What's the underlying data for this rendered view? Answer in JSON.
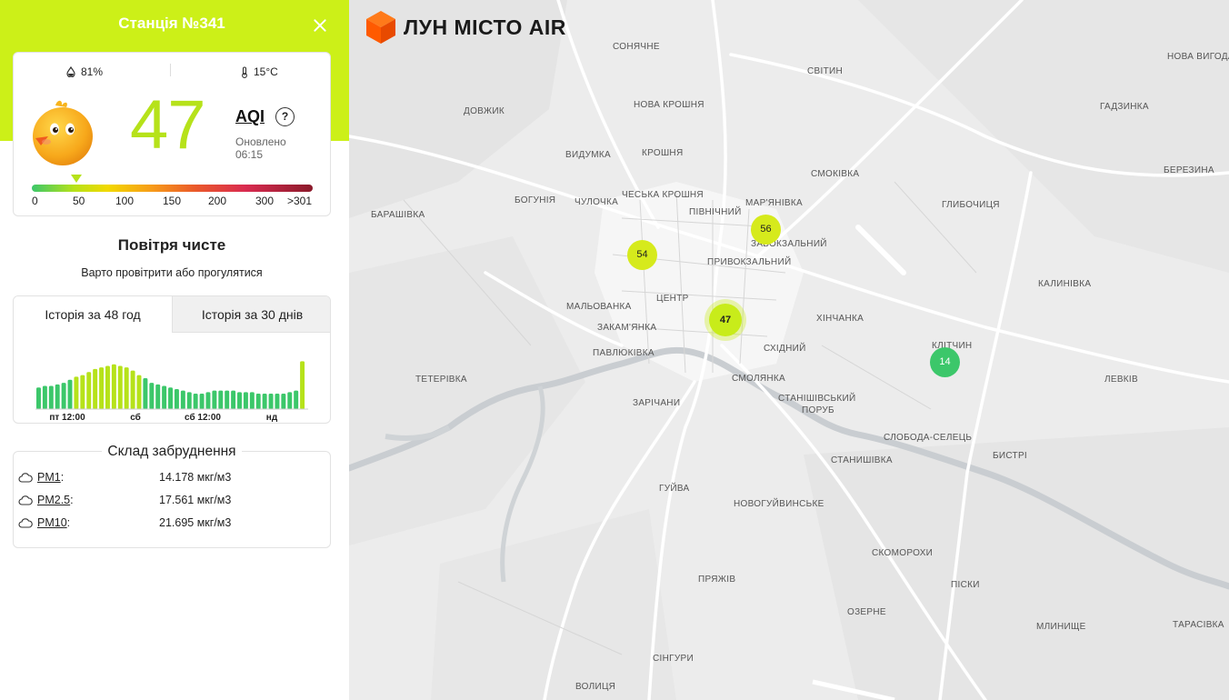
{
  "station": {
    "title": "Станція №341"
  },
  "meta": {
    "humidity": "81%",
    "temperature": "15°C"
  },
  "aqi": {
    "value": "47",
    "label": "AQI",
    "help": "?",
    "updated_label": "Оновлено",
    "updated_time": "06:15",
    "scale_ticks": [
      "0",
      "50",
      "100",
      "150",
      "200",
      "300",
      ">301"
    ],
    "color": "#b6e21a"
  },
  "status": {
    "title": "Повітря чисте",
    "advice": "Варто провітрити або прогулятися"
  },
  "history": {
    "tabs": [
      "Історія за 48 год",
      "Історія за 30 днів"
    ],
    "x_labels": [
      "пт 12:00",
      "сб",
      "сб 12:00",
      "нд"
    ]
  },
  "chart_data": {
    "type": "bar",
    "title": "",
    "values": [
      14,
      15,
      15,
      16,
      17,
      19,
      21,
      22,
      24,
      26,
      27,
      28,
      29,
      28,
      27,
      25,
      22,
      20,
      17,
      16,
      15,
      14,
      13,
      12,
      11,
      10,
      10,
      11,
      12,
      12,
      12,
      12,
      11,
      11,
      11,
      10,
      10,
      10,
      10,
      10,
      11,
      12,
      31
    ],
    "x_tick_labels": [
      "пт 12:00",
      "сб",
      "сб 12:00",
      "нд"
    ],
    "colors": [
      "#3cc76a",
      "#b6e21a"
    ]
  },
  "pollution": {
    "title": "Склад забруднення",
    "items": [
      {
        "name": "PM1",
        "sep": " :",
        "value": "14.178 мкг/м3"
      },
      {
        "name": "PM2.5",
        "sep": " :",
        "value": "17.561 мкг/м3"
      },
      {
        "name": "PM10",
        "sep": " :",
        "value": "21.695 мкг/м3"
      }
    ]
  },
  "map": {
    "logo": "ЛУН МІСТО AIR",
    "places": [
      "СОНЯЧНЕ",
      "СВІТИН",
      "НОВА ВИГОДА",
      "ДОВЖИК",
      "НОВА КРОШНЯ",
      "ГАДЗИНКА",
      "ВИДУМКА",
      "КРОШНЯ",
      "СМОКІВКА",
      "БЕРЕЗИНА",
      "БОГУНІЯ",
      "ЧУЛОЧКА",
      "ЧЕСЬКА КРОШНЯ",
      "МАР'ЯНІВКА",
      "ГЛИБОЧИЦЯ",
      "БАРАШІВКА",
      "ПІВНІЧНИЙ",
      "ЗАВОКЗАЛЬНИЙ",
      "ПРИВОКЗАЛЬНИЙ",
      "КАЛИНІВКА",
      "ЦЕНТР",
      "МАЛЬОВАНКА",
      "ХІНЧАНКА",
      "ЗАКАМ'ЯНКА",
      "СХІДНИЙ",
      "КЛІТЧИН",
      "ПАВЛЮКІВКА",
      "ТЕТЕРІВКА",
      "СМОЛЯНКА",
      "ЛЕВКІВ",
      "ЗАРІЧАНИ",
      "СТАНІШІВСЬКИЙ",
      "ПОРУБ",
      "СЛОБОДА-СЕЛЕЦЬ",
      "БИСТРІ",
      "СТАНИШІВКА",
      "ГУЙВА",
      "НОВОГУЙВИНСЬКЕ",
      "СКОМОРОХИ",
      "ПІСКИ",
      "ПРЯЖІВ",
      "ОЗЕРНЕ",
      "МЛИНИЩЕ",
      "ТАРАСІВКА",
      "СІНГУРИ",
      "ВОЛИЦЯ"
    ],
    "markers": [
      {
        "value": "54",
        "color": "#d6ea1c"
      },
      {
        "value": "56",
        "color": "#d6ea1c"
      },
      {
        "value": "47",
        "color": "#c8ec1a"
      },
      {
        "value": "14",
        "color": "#3cc76a"
      }
    ]
  }
}
